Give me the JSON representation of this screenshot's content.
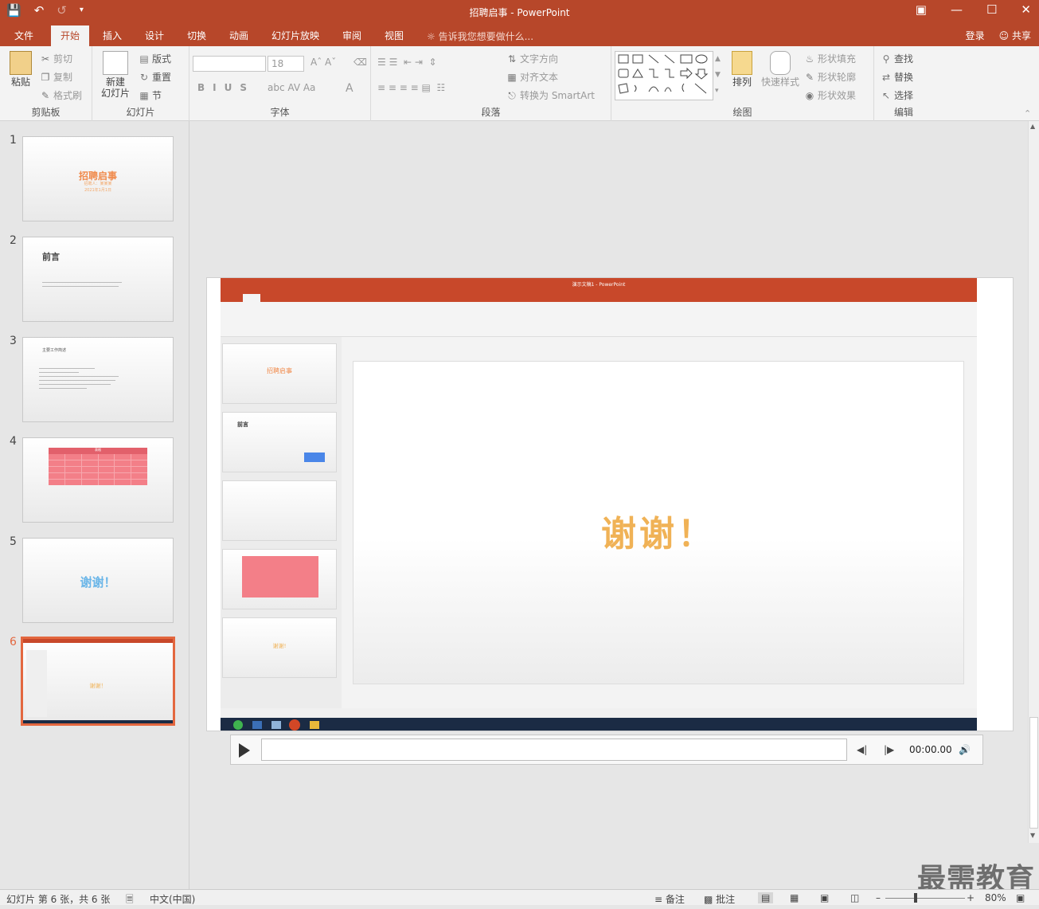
{
  "window": {
    "title": "招聘启事 - PowerPoint",
    "login": "登录",
    "share": "共享"
  },
  "tabs": [
    "文件",
    "开始",
    "插入",
    "设计",
    "切换",
    "动画",
    "幻灯片放映",
    "审阅",
    "视图"
  ],
  "tell_me": "告诉我您想要做什么...",
  "ribbon": {
    "clipboard": {
      "label": "剪贴板",
      "paste": "粘贴",
      "cut": "剪切",
      "copy": "复制",
      "format_painter": "格式刷"
    },
    "slides": {
      "label": "幻灯片",
      "new_slide_1": "新建",
      "new_slide_2": "幻灯片",
      "layout": "版式",
      "reset": "重置",
      "section": "节"
    },
    "font": {
      "label": "字体",
      "font_name": "",
      "font_size": "18"
    },
    "paragraph": {
      "label": "段落",
      "text_direction": "文字方向",
      "align_text": "对齐文本",
      "smartart": "转换为 SmartArt"
    },
    "drawing": {
      "label": "绘图",
      "arrange": "排列",
      "quick_styles": "快速样式",
      "shape_fill": "形状填充",
      "shape_outline": "形状轮廓",
      "shape_effects": "形状效果"
    },
    "editing": {
      "label": "编辑",
      "find": "查找",
      "replace": "替换",
      "select": "选择"
    }
  },
  "thumbnails": [
    {
      "num": "1",
      "title": "招聘启事",
      "subtitle": "招聘人：某某某",
      "date": "2021年1月1日"
    },
    {
      "num": "2",
      "title": "前言"
    },
    {
      "num": "3",
      "title": "主要工作简述"
    },
    {
      "num": "4",
      "title": "表格"
    },
    {
      "num": "5",
      "title": "谢谢！"
    },
    {
      "num": "6",
      "title": "谢谢！"
    }
  ],
  "slide": {
    "video_title": "演示文稿1 - PowerPoint",
    "thanks_text": "谢谢！",
    "inner_thumb1": "招聘启事",
    "inner_thumb2": "前言",
    "inner_thumb5": "谢谢!"
  },
  "media": {
    "time": "00:00.00"
  },
  "status": {
    "slide_info": "幻灯片 第 6 张，共 6 张",
    "language": "中文(中国)",
    "notes": "备注",
    "comments": "批注",
    "zoom": "80%"
  },
  "watermark": "最需教育",
  "colors": {
    "accent": "#b7472a",
    "selected_border": "#e3673f",
    "thanks": "#f0b256"
  }
}
